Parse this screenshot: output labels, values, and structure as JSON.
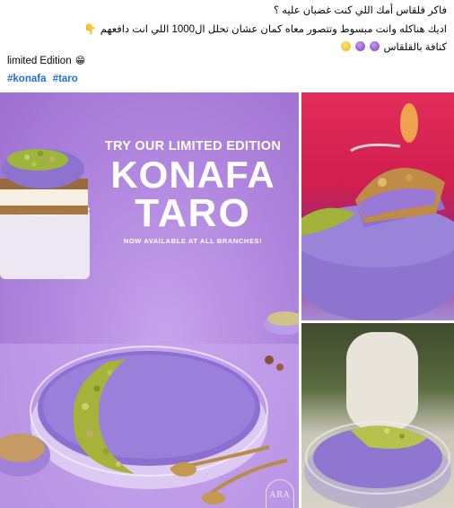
{
  "post": {
    "line1": "فاكر قلقاس أمك اللي كنت غضبان عليه ؟",
    "line2_emoji": "👇",
    "line2": "اديك هناكله وانت مبسوط وتتصور معاه كمان عشان تحلل ال1000 اللي انت دافعهم",
    "line3": "كنافة بالقلقاس",
    "line4": "limited Edition",
    "line4_emoji": "😁",
    "hashtags": [
      "#konafa",
      "#taro"
    ]
  },
  "media": {
    "promo": {
      "kicker": "TRY OUR LIMITED EDITION",
      "title_line1": "KONAFA",
      "title_line2": "TARO",
      "subtitle": "NOW AVAILABLE AT ALL BRANCHES!",
      "brand": "ARA"
    }
  },
  "colors": {
    "hashtag": "#216fdb",
    "promo_bg": "#b38ae0",
    "taro_purple": "#8e6fcf",
    "pistachio": "#a7b43a"
  }
}
